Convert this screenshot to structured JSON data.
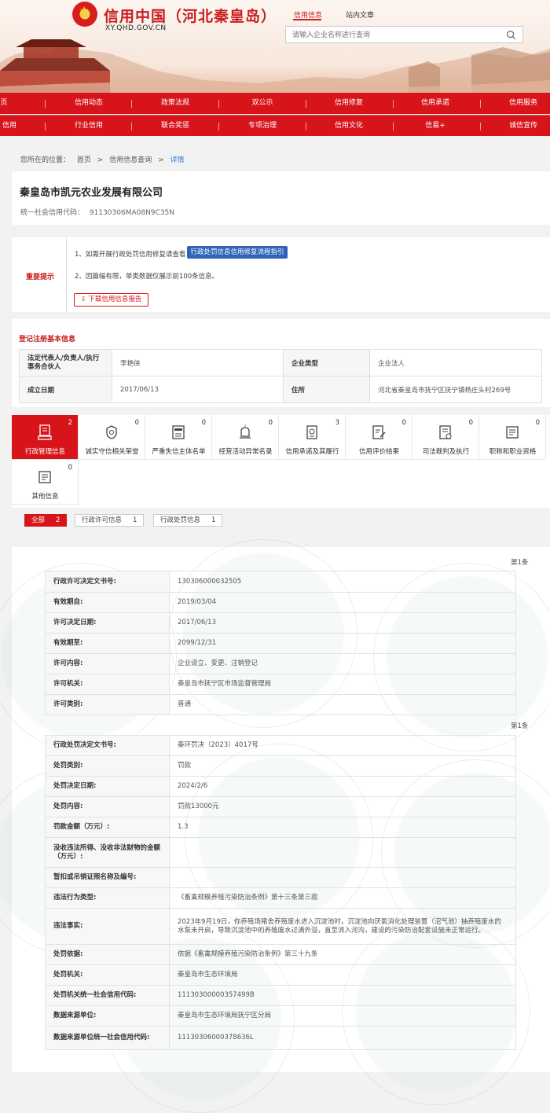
{
  "site": {
    "title": "信用中国（河北秦皇岛）",
    "domain": "XY.QHD.GOV.CN",
    "header_tabs": [
      "信用信息",
      "站内文章"
    ],
    "search_placeholder": "请输入企业名称进行查询"
  },
  "nav": {
    "row1": [
      "页",
      "信用动态",
      "政策法规",
      "双公示",
      "信用修复",
      "信用承诺",
      "信用服务"
    ],
    "row2": [
      "信用",
      "行业信用",
      "联合奖惩",
      "专项治理",
      "信用文化",
      "信易+",
      "诚信宣传"
    ]
  },
  "breadcrumb": {
    "prefix": "您所在的位置：",
    "items": [
      "首页",
      "信用信息查询",
      "详情"
    ],
    "separator": ">"
  },
  "company": {
    "name": "秦皇岛市凯元农业发展有限公司",
    "credit_code_label": "统一社会信用代码：",
    "credit_code": "91130306MA08N9C35N"
  },
  "notice": {
    "label": "重要提示",
    "line1": "1、如需开展行政处罚信用修复请查看",
    "guide_button": "行政处罚信息信用修复流程指引",
    "line2": "2、因篇幅有限，单类数据仅展示前100条信息。",
    "download_button": "下载信用信息报告"
  },
  "registration": {
    "title": "登记注册基本信息",
    "rows": [
      {
        "k1": "法定代表人/负责人/执行事务合伙人",
        "v1": "李艳侠",
        "k2": "企业类型",
        "v2": "企业法人"
      },
      {
        "k1": "成立日期",
        "v1": "2017/06/13",
        "k2": "住所",
        "v2": "河北省秦皇岛市抚宁区抚宁镇杨庄头村269号"
      }
    ]
  },
  "categories": [
    {
      "label": "行政管理信息",
      "count": "2",
      "icon": "document-stamp-icon"
    },
    {
      "label": "诚实守信相关荣誉",
      "count": "0",
      "icon": "medal-icon"
    },
    {
      "label": "严重失信主体名单",
      "count": "0",
      "icon": "blacklist-icon"
    },
    {
      "label": "经营活动异常名录",
      "count": "0",
      "icon": "alarm-icon"
    },
    {
      "label": "信用承诺及其履行",
      "count": "3",
      "icon": "commitment-icon"
    },
    {
      "label": "信用评价结果",
      "count": "0",
      "icon": "evaluation-icon"
    },
    {
      "label": "司法裁判及执行",
      "count": "0",
      "icon": "judicial-icon"
    },
    {
      "label": "职称和职业资格",
      "count": "0",
      "icon": "certificate-icon"
    },
    {
      "label": "其他信息",
      "count": "0",
      "icon": "other-info-icon"
    }
  ],
  "filters": [
    {
      "label": "全部",
      "count": "2"
    },
    {
      "label": "行政许可信息",
      "count": "1"
    },
    {
      "label": "行政处罚信息",
      "count": "1"
    }
  ],
  "records": {
    "permit": {
      "page": "第1条",
      "rows": [
        {
          "k": "行政许可决定文书号:",
          "v": "130306000032505"
        },
        {
          "k": "有效期自:",
          "v": "2019/03/04"
        },
        {
          "k": "许可决定日期:",
          "v": "2017/06/13"
        },
        {
          "k": "有效期至:",
          "v": "2099/12/31"
        },
        {
          "k": "许可内容:",
          "v": "企业设立、变更、注销登记"
        },
        {
          "k": "许可机关:",
          "v": "秦皇岛市抚宁区市场监督管理局"
        },
        {
          "k": "许可类别:",
          "v": "普通"
        }
      ]
    },
    "penalty": {
      "page": "第1条",
      "rows": [
        {
          "k": "行政处罚决定文书号:",
          "v": "秦环罚决（2023）4017号"
        },
        {
          "k": "处罚类别:",
          "v": "罚款"
        },
        {
          "k": "处罚决定日期:",
          "v": "2024/2/6"
        },
        {
          "k": "处罚内容:",
          "v": "罚款13000元"
        },
        {
          "k": "罚款金额（万元）:",
          "v": "1.3"
        },
        {
          "k": "没收违法所得、没收非法财物的金额（万元）:",
          "v": ""
        },
        {
          "k": "暂扣或吊销证照名称及编号:",
          "v": ""
        },
        {
          "k": "违法行为类型:",
          "v": "《畜禽规模养殖污染防治条例》第十三条第三款"
        },
        {
          "k": "违法事实:",
          "v": "2023年9月19日，你养殖场猪舍养殖废水进入沉淀池时，沉淀池向厌氧消化处理装置（沼气池）抽养殖废水的水泵未开启，导致沉淀池中的养殖废水过满外溢，直至流入河沟，建设的污染防治配套设施未正常运行。"
        },
        {
          "k": "处罚依据:",
          "v": "依据《畜禽规模养殖污染防治条例》第三十九条"
        },
        {
          "k": "处罚机关:",
          "v": "秦皇岛市生态环境局"
        },
        {
          "k": "处罚机关统一社会信用代码:",
          "v": "11130300000357499B"
        },
        {
          "k": "数据来源单位:",
          "v": "秦皇岛市生态环境局抚宁区分局"
        },
        {
          "k": "数据来源单位统一社会信用代码:",
          "v": "11130306000378636L"
        }
      ]
    }
  },
  "colors": {
    "brand": "#d7141a",
    "accent_blue": "#2e63b8",
    "link": "#2d7fd6"
  }
}
